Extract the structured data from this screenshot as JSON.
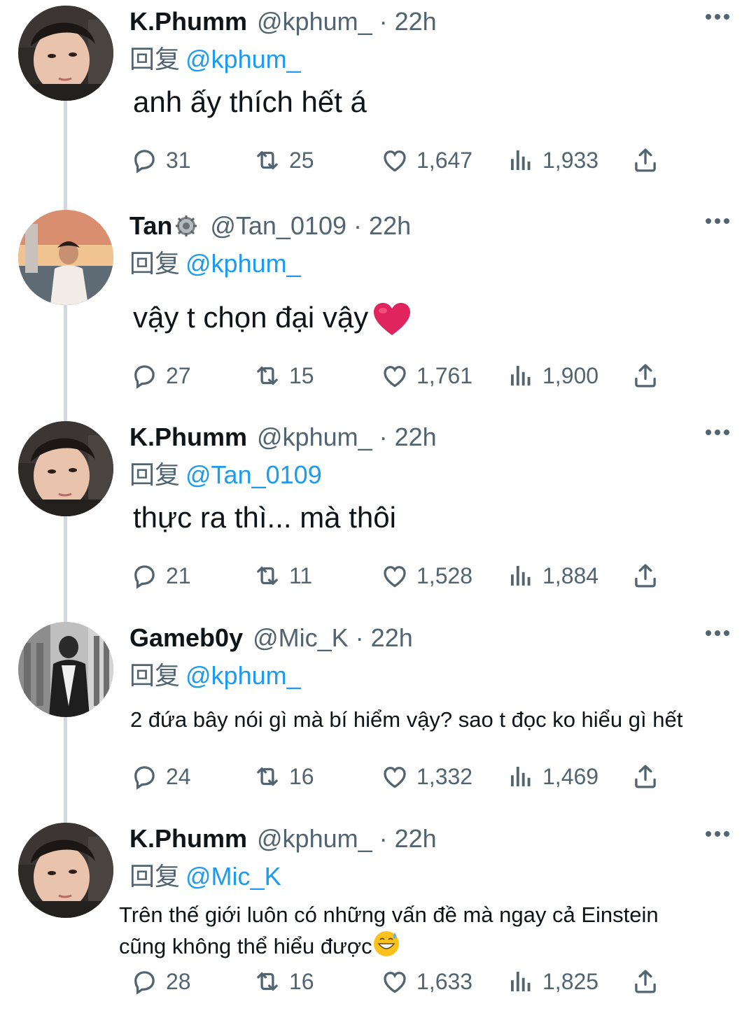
{
  "reply_prefix": "回复",
  "colors": {
    "name": "#0f1419",
    "muted": "#536471",
    "link": "#1d9bf0",
    "thread_line": "#cfd9de",
    "heart_red": "#e0245e"
  },
  "tweets": [
    {
      "avatar": "avatar-kphumm",
      "name": "K.Phumm",
      "handle": "@kphum_",
      "time": "22h",
      "reply_to": "@kphum_",
      "text": "anh ấy thích hết á",
      "stats": {
        "replies": "31",
        "retweets": "25",
        "likes": "1,647",
        "views": "1,933"
      }
    },
    {
      "avatar": "avatar-tan",
      "name": "Tan",
      "badge_icon": "gear-badge-icon",
      "handle": "@Tan_0109",
      "time": "22h",
      "reply_to": "@kphum_",
      "text": "vậy t chọn đại vậy",
      "emoji": "red-heart-emoji",
      "stats": {
        "replies": "27",
        "retweets": "15",
        "likes": "1,761",
        "views": "1,900"
      }
    },
    {
      "avatar": "avatar-kphumm",
      "name": "K.Phumm",
      "handle": "@kphum_",
      "time": "22h",
      "reply_to": "@Tan_0109",
      "text": "thực ra thì... mà thôi",
      "stats": {
        "replies": "21",
        "retweets": "11",
        "likes": "1,528",
        "views": "1,884"
      }
    },
    {
      "avatar": "avatar-gameb0y",
      "name": "Gameb0y",
      "handle": "@Mic_K",
      "time": "22h",
      "reply_to": "@kphum_",
      "text": "2 đứa bây nói gì mà bí hiểm vậy? sao t đọc ko hiểu gì hết",
      "stats": {
        "replies": "24",
        "retweets": "16",
        "likes": "1,332",
        "views": "1,469"
      }
    },
    {
      "avatar": "avatar-kphumm",
      "name": "K.Phumm",
      "handle": "@kphum_",
      "time": "22h",
      "reply_to": "@Mic_K",
      "text_line1": "Trên thế giới luôn có những vấn đề mà ngay cả Einstein",
      "text_line2": "cũng không thể hiểu được",
      "emoji": "grinning-sweat-emoji",
      "stats": {
        "replies": "28",
        "retweets": "16",
        "likes": "1,633",
        "views": "1,825"
      }
    }
  ]
}
